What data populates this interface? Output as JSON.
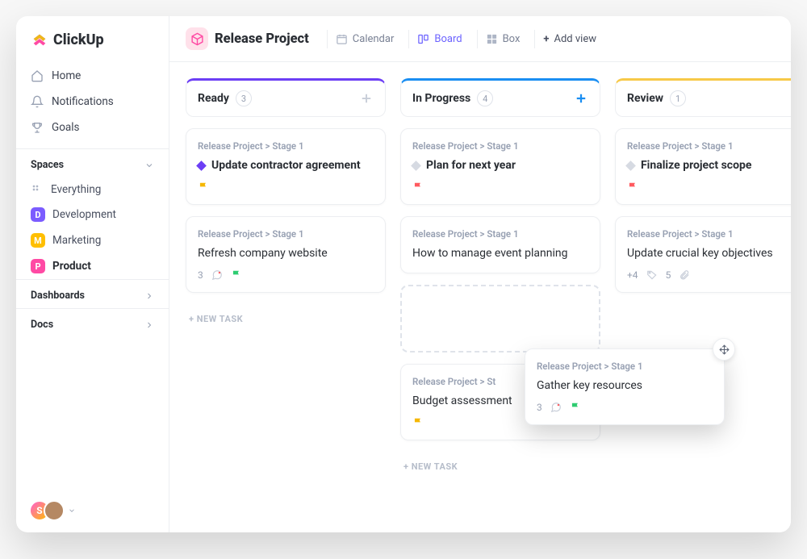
{
  "brand": "ClickUp",
  "nav": {
    "home": "Home",
    "notifications": "Notifications",
    "goals": "Goals"
  },
  "spaces": {
    "header": "Spaces",
    "everything": "Everything",
    "items": [
      {
        "letter": "D",
        "label": "Development",
        "color": "#7b5cff"
      },
      {
        "letter": "M",
        "label": "Marketing",
        "color": "#ffbf00"
      },
      {
        "letter": "P",
        "label": "Product",
        "color": "#ff4aa4"
      }
    ]
  },
  "sections": {
    "dashboards": "Dashboards",
    "docs": "Docs"
  },
  "avatars": [
    {
      "letter": "S",
      "bg": "linear-gradient(135deg,#ff5ed1,#ffbf00)"
    }
  ],
  "header": {
    "project": "Release Project",
    "views": {
      "calendar": "Calendar",
      "board": "Board",
      "box": "Box",
      "add": "Add view"
    }
  },
  "board": {
    "columns": [
      {
        "title": "Ready",
        "count": "3",
        "color": "purple",
        "cards": [
          {
            "breadcrumb": "Release Project > Stage 1",
            "title": "Update contractor agreement",
            "bold": true,
            "diamond": "purple",
            "flag": "yellow"
          },
          {
            "breadcrumb": "Release Project > Stage 1",
            "title": "Refresh company website",
            "bold": false,
            "comments": "3",
            "flag": "green"
          }
        ],
        "newTask": "+ NEW TASK"
      },
      {
        "title": "In Progress",
        "count": "4",
        "color": "blue",
        "cards": [
          {
            "breadcrumb": "Release Project > Stage 1",
            "title": "Plan for next year",
            "bold": true,
            "diamond": "grey",
            "flag": "red"
          },
          {
            "breadcrumb": "Release Project > Stage 1",
            "title": "How to manage event planning",
            "bold": false
          },
          {
            "placeholder": true
          },
          {
            "breadcrumb": "Release Project > St",
            "title": "Budget assessment",
            "bold": false,
            "flag": "yellow"
          }
        ],
        "newTask": "+ NEW TASK"
      },
      {
        "title": "Review",
        "count": "1",
        "color": "yellow",
        "cards": [
          {
            "breadcrumb": "Release Project > Stage 1",
            "title": "Finalize project scope",
            "bold": true,
            "diamond": "grey",
            "flag": "red"
          },
          {
            "breadcrumb": "Release Project > Stage 1",
            "title": "Update crucial key objectives",
            "bold": false,
            "tags": "+4",
            "clips": "5"
          }
        ]
      }
    ],
    "dragging": {
      "breadcrumb": "Release Project > Stage 1",
      "title": "Gather key resources",
      "comments": "3",
      "flag": "green"
    }
  }
}
